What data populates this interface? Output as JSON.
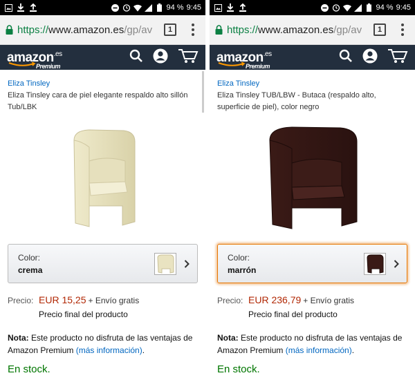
{
  "status": {
    "battery": "94 %",
    "time": "9:45"
  },
  "browser": {
    "url_proto": "https://",
    "url_host": "www.amazon.es",
    "url_path": "/gp/av",
    "tab_count": "1"
  },
  "amazon": {
    "logo": "amazon",
    "logo_suffix": ".es",
    "premium": "Premium"
  },
  "colors": {
    "accent_orange": "#e77600",
    "price_red": "#b12704",
    "link_blue": "#0066c0",
    "stock_green": "#007600",
    "amazon_navy": "#232f3e"
  },
  "screens": [
    {
      "brand": "Eliza Tinsley",
      "title": "Eliza Tinsley cara de piel elegante respaldo alto sillón Tub/LBK",
      "color_label": "Color:",
      "color_value": "crema",
      "price_label": "Precio:",
      "price": "EUR 15,25",
      "shipping": "+ Envío gratis",
      "final_price": "Precio final del producto",
      "note_bold": "Nota:",
      "note_text": " Este producto no disfruta de las ventajas de Amazon Premium ",
      "note_link": "(más información)",
      "note_end": ".",
      "stock": "En stock.",
      "product_color": "cream"
    },
    {
      "brand": "Eliza Tinsley",
      "title": "Eliza Tinsley TUB/LBW - Butaca (respaldo alto, superficie de piel), color negro",
      "color_label": "Color:",
      "color_value": "marrón",
      "price_label": "Precio:",
      "price": "EUR 236,79",
      "shipping": "+ Envío gratis",
      "final_price": "Precio final del producto",
      "note_bold": "Nota:",
      "note_text": " Este producto no disfruta de las ventajas de Amazon Premium ",
      "note_link": "(más información)",
      "note_end": ".",
      "stock": "En stock.",
      "product_color": "brown"
    }
  ]
}
